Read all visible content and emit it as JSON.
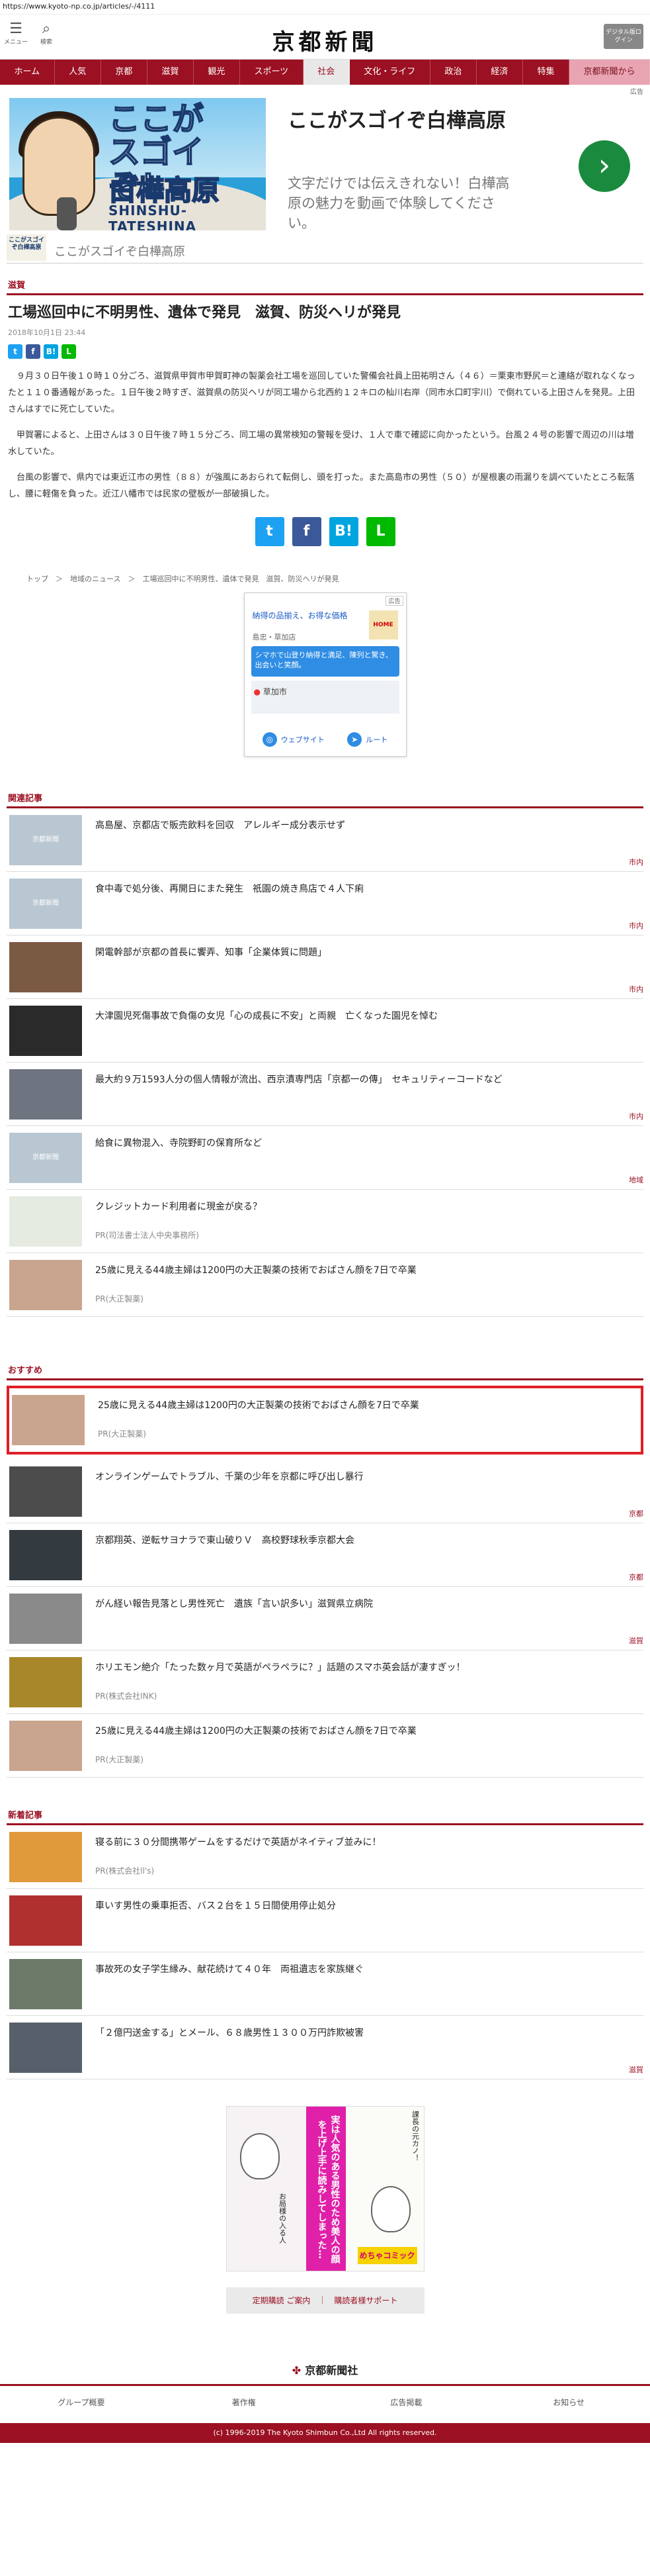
{
  "url": "https://www.kyoto-np.co.jp/articles/-/4111",
  "header": {
    "menu_label": "メニュー",
    "search_label": "検索",
    "logo": "京都新聞",
    "login_label": "デジタル版ログイン"
  },
  "nav": [
    "ホーム",
    "人気",
    "京都",
    "滋賀",
    "観光",
    "スポーツ",
    "社会",
    "文化・ライフ",
    "政治",
    "経済",
    "特集",
    "京都新聞から"
  ],
  "ad_top": {
    "label": "広告",
    "visual_line1": "ここが",
    "visual_line2": "スゴイぞ！",
    "visual_line3": "白樺高原",
    "visual_line4": "SHINSHU-TATESHINA",
    "title": "ここがスゴイぞ白樺高原",
    "desc": "文字だけでは伝えきれない！白樺高原の魅力を動画で体験してください。",
    "footer_logo": "ここがスゴイぞ白樺高原",
    "footer_text": "ここがスゴイぞ白樺高原"
  },
  "article": {
    "category": "滋賀",
    "title": "工場巡回中に不明男性、遺体で発見　滋賀、防災ヘリが発見",
    "date": "2018年10月1日 23:44",
    "p1": "９月３０日午後１０時１０分ごろ、滋賀県甲賀市甲賀町神の製薬会社工場を巡回していた警備会社員上田祐明さん（４６）＝栗東市野尻＝と連絡が取れなくなったと１１０番通報があった。１日午後２時すぎ、滋賀県の防災ヘリが同工場から北西約１２キロの杣川右岸（同市水口町宇川）で倒れている上田さんを発見。上田さんはすでに死亡していた。",
    "p2": "甲賀署によると、上田さんは３０日午後７時１５分ごろ、同工場の異常検知の警報を受け、１人で車で確認に向かったという。台風２４号の影響で周辺の川は増水していた。",
    "p3": "台風の影響で、県内では東近江市の男性（８８）が強風にあおられて転倒し、頭を打った。また高島市の男性（５０）が屋根裏の雨漏りを調べていたところ転落し、腰に軽傷を負った。近江八幡市では民家の壁板が一部破損した。"
  },
  "share": {
    "tw": "t",
    "fb": "f",
    "hb": "B!",
    "ln": "L"
  },
  "breadcrumb": "トップ　＞　地域のニュース　＞　工場巡回中に不明男性、遺体で発見　滋賀、防災ヘリが発見",
  "map_ad": {
    "label": "広告",
    "title": "納得の品揃え、お得な価格",
    "sub": "島忠・草加店",
    "thumb": "HOME",
    "blue": "シマホで山登り納得と満足、陳列と驚き、出会いと笑顔。",
    "place": "草加市",
    "btn_web": "ウェブサイト",
    "btn_route": "ルート"
  },
  "related_label": "関連記事",
  "related": [
    {
      "title": "高島屋、京都店で販売飲料を回収　アレルギー成分表示せず",
      "tag": "市内",
      "img": "京都新聞"
    },
    {
      "title": "食中毒で処分後、再開日にまた発生　祇園の焼き鳥店で４人下痢",
      "tag": "市内",
      "img": "京都新聞"
    },
    {
      "title": "閑電幹部が京都の首長に饗弄、知事「企業体質に問題」",
      "tag": "市内",
      "img": ""
    },
    {
      "title": "大津園児死傷事故で負傷の女児「心の成長に不安」と両親　亡くなった園児を悼む",
      "tag": "",
      "img": ""
    },
    {
      "title": "最大約９万1593人分の個人情報が流出、西京漬専門店「京都一の傳」　セキュリティーコードなど",
      "tag": "市内",
      "img": ""
    },
    {
      "title": "給食に異物混入、寺院野町の保育所など",
      "tag": "地域",
      "img": "京都新聞"
    },
    {
      "title": "クレジットカード利用者に現金が戻る？",
      "pr": "PR(司法書士法人中央事務所)",
      "img": ""
    },
    {
      "title": "25歳に見える44歳主婦は1200円の大正製薬の技術でおばさん顔を7日で卒業",
      "pr": "PR(大正製薬)",
      "img": ""
    }
  ],
  "recommend_label": "おすすめ",
  "recommend": [
    {
      "title": "25歳に見える44歳主婦は1200円の大正製薬の技術でおばさん顔を7日で卒業",
      "pr": "PR(大正製薬)",
      "tag": ""
    },
    {
      "title": "オンラインゲームでトラブル、千葉の少年を京都に呼び出し暴行",
      "tag": "京都"
    },
    {
      "title": "京都翔英、逆転サヨナラで東山破りＶ　高校野球秋季京都大会",
      "tag": "京都"
    },
    {
      "title": "がん経い報告見落とし男性死亡　遺族「言い訳多い」滋賀県立病院",
      "tag": "滋賀"
    },
    {
      "title": "ホリエモン絶介「たった数ヶ月で英語がペラペラに？」話題のスマホ英会話が凄すぎッ！",
      "pr": "PR(株式会社INK)"
    },
    {
      "title": "25歳に見える44歳主婦は1200円の大正製薬の技術でおばさん顔を7日で卒業",
      "pr": "PR(大正製薬)"
    }
  ],
  "new_label": "新着記事",
  "new_articles": [
    {
      "title": "寝る前に３０分間携帯ゲームをするだけで英語がネイティブ並みに！",
      "pr": "PR(株式会社ll's)"
    },
    {
      "title": "車いす男性の乗車拒否、バス２台を１５日間使用停止処分",
      "tag": ""
    },
    {
      "title": "事故死の女子学生縁み、献花続けて４０年　両祖遺志を家族継ぐ",
      "tag": ""
    },
    {
      "title": "「２億円送金する」とメール、６８歳男性１３００万円詐欺被害",
      "tag": "滋賀"
    }
  ],
  "footer_ad": {
    "mid": "実は人気のある男性のため美人の顔を上げ上手に読みしてしまった…",
    "label1": "課長の元カノ！",
    "label2": "お局様の入る人",
    "logo": "めちゃコミック"
  },
  "footer_links": "定期購読 ご案内　｜　購読者様サポート",
  "company": "京都新聞社",
  "foot_nav": [
    "グループ概要",
    "著作権",
    "広告掲載",
    "お知らせ"
  ],
  "copyright": "(c) 1996-2019 The Kyoto Shimbun Co.,Ltd All rights reserved."
}
